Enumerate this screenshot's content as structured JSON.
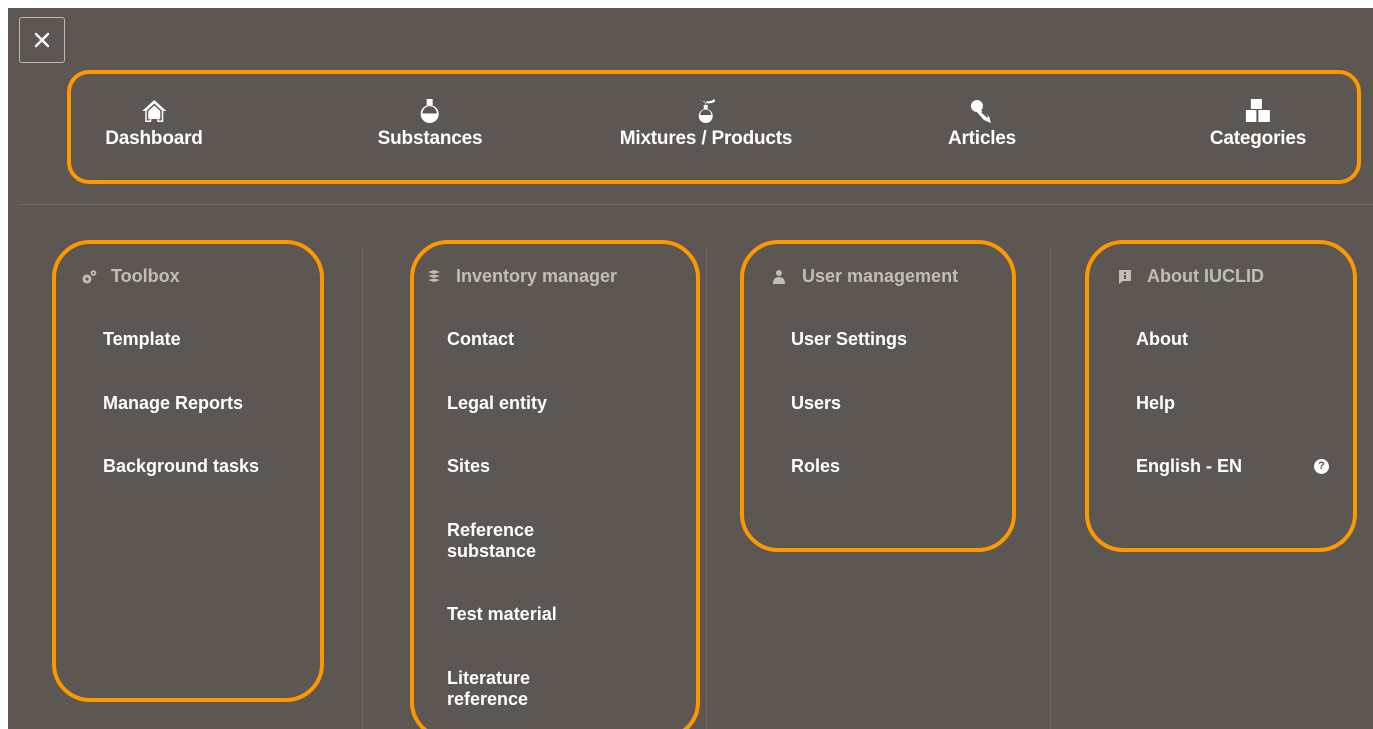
{
  "close": {
    "icon": "close-icon"
  },
  "nav": {
    "items": [
      {
        "label": "Dashboard",
        "icon": "home-icon"
      },
      {
        "label": "Substances",
        "icon": "flask-icon"
      },
      {
        "label": "Mixtures / Products",
        "icon": "mixture-spray-icon"
      },
      {
        "label": "Articles",
        "icon": "article-pin-icon"
      },
      {
        "label": "Categories",
        "icon": "categories-boxes-icon"
      }
    ]
  },
  "sections": {
    "toolbox": {
      "title": "Toolbox",
      "icon": "gears-icon",
      "items": [
        "Template",
        "Manage Reports",
        "Background tasks"
      ]
    },
    "inventory": {
      "title": "Inventory manager",
      "icon": "stack-icon",
      "items": [
        "Contact",
        "Legal entity",
        "Sites",
        "Reference substance",
        "Test material",
        "Literature reference"
      ]
    },
    "users": {
      "title": "User management",
      "icon": "user-icon",
      "items": [
        "User Settings",
        "Users",
        "Roles"
      ]
    },
    "about": {
      "title": "About IUCLID",
      "icon": "info-bookmark-icon",
      "items": [
        "About",
        "Help",
        "English - EN"
      ],
      "help_glyph": "?"
    }
  },
  "colors": {
    "background": "#5c5753",
    "highlight": "#ff9800",
    "text": "#ffffff",
    "muted_text": "#c2bdb8"
  }
}
